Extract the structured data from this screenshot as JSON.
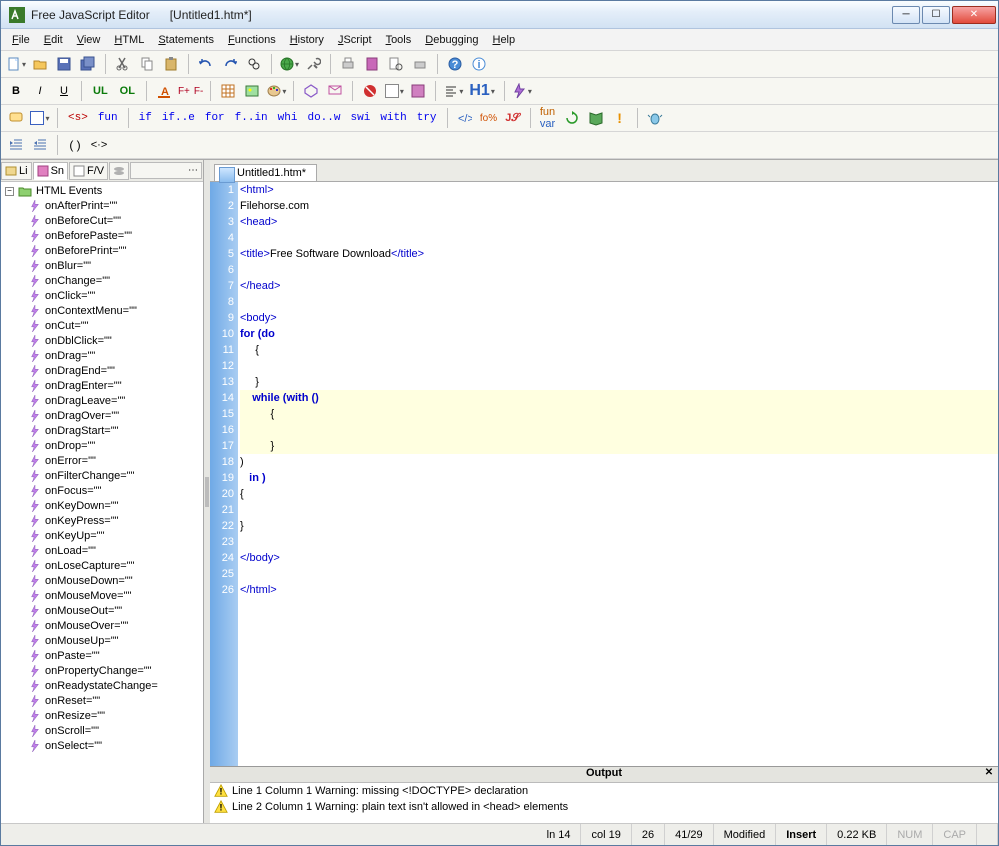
{
  "window": {
    "app_title": "Free JavaScript Editor",
    "doc_title": "[Untitled1.htm*]"
  },
  "menu": [
    "File",
    "Edit",
    "View",
    "HTML",
    "Statements",
    "Functions",
    "History",
    "JScript",
    "Tools",
    "Debugging",
    "Help"
  ],
  "snippet_bar": [
    "<s>",
    "fun",
    "if",
    "if..e",
    "for",
    "f..in",
    "whi",
    "do..w",
    "swi",
    "with",
    "try"
  ],
  "side_tabs": [
    "Li",
    "Sn",
    "F/V"
  ],
  "tree": {
    "root": "HTML Events",
    "items": [
      "onAfterPrint=\"\"",
      "onBeforeCut=\"\"",
      "onBeforePaste=\"\"",
      "onBeforePrint=\"\"",
      "onBlur=\"\"",
      "onChange=\"\"",
      "onClick=\"\"",
      "onContextMenu=\"\"",
      "onCut=\"\"",
      "onDblClick=\"\"",
      "onDrag=\"\"",
      "onDragEnd=\"\"",
      "onDragEnter=\"\"",
      "onDragLeave=\"\"",
      "onDragOver=\"\"",
      "onDragStart=\"\"",
      "onDrop=\"\"",
      "onError=\"\"",
      "onFilterChange=\"\"",
      "onFocus=\"\"",
      "onKeyDown=\"\"",
      "onKeyPress=\"\"",
      "onKeyUp=\"\"",
      "onLoad=\"\"",
      "onLoseCapture=\"\"",
      "onMouseDown=\"\"",
      "onMouseMove=\"\"",
      "onMouseOut=\"\"",
      "onMouseOver=\"\"",
      "onMouseUp=\"\"",
      "onPaste=\"\"",
      "onPropertyChange=\"\"",
      "onReadystateChange=",
      "onReset=\"\"",
      "onResize=\"\"",
      "onScroll=\"\"",
      "onSelect=\"\""
    ]
  },
  "editor": {
    "tab": "Untitled1.htm*",
    "lines": [
      {
        "n": 1,
        "cls": "tag",
        "t": "<html>"
      },
      {
        "n": 2,
        "cls": "txt-line",
        "t": "Filehorse.com"
      },
      {
        "n": 3,
        "cls": "tag",
        "t": "<head>"
      },
      {
        "n": 4,
        "cls": "",
        "t": ""
      },
      {
        "n": 5,
        "cls": "mixed",
        "t": "<title>Free Software Download</title>"
      },
      {
        "n": 6,
        "cls": "",
        "t": ""
      },
      {
        "n": 7,
        "cls": "tag",
        "t": "</head>"
      },
      {
        "n": 8,
        "cls": "",
        "t": ""
      },
      {
        "n": 9,
        "cls": "tag",
        "t": "<body>"
      },
      {
        "n": 10,
        "cls": "kw",
        "t": "for (do"
      },
      {
        "n": 11,
        "cls": "txt-line",
        "t": "     {"
      },
      {
        "n": 12,
        "cls": "",
        "t": ""
      },
      {
        "n": 13,
        "cls": "txt-line",
        "t": "     }"
      },
      {
        "n": 14,
        "cls": "kw hl",
        "t": "    while (with ()"
      },
      {
        "n": 15,
        "cls": "txt-line hl",
        "t": "          {"
      },
      {
        "n": 16,
        "cls": "hl",
        "t": ""
      },
      {
        "n": 17,
        "cls": "txt-line hl",
        "t": "          }"
      },
      {
        "n": 18,
        "cls": "txt-line",
        "t": ")"
      },
      {
        "n": 19,
        "cls": "kw",
        "t": "   in )"
      },
      {
        "n": 20,
        "cls": "txt-line",
        "t": "{"
      },
      {
        "n": 21,
        "cls": "",
        "t": ""
      },
      {
        "n": 22,
        "cls": "txt-line",
        "t": "}"
      },
      {
        "n": 23,
        "cls": "",
        "t": ""
      },
      {
        "n": 24,
        "cls": "tag",
        "t": "</body>"
      },
      {
        "n": 25,
        "cls": "",
        "t": ""
      },
      {
        "n": 26,
        "cls": "tag",
        "t": "</html>"
      }
    ]
  },
  "output": {
    "title": "Output",
    "lines": [
      "Line 1 Column 1  Warning: missing <!DOCTYPE> declaration",
      "Line 2 Column 1  Warning: plain text isn't allowed in <head> elements"
    ]
  },
  "status": {
    "ln": "ln 14",
    "col": "col 19",
    "sel": "26",
    "pos": "41/29",
    "modified": "Modified",
    "insert": "Insert",
    "size": "0.22 KB",
    "num": "NUM",
    "cap": "CAP"
  },
  "labels": {
    "B": "B",
    "I": "I",
    "U": "U",
    "UL": "UL",
    "OL": "OL",
    "F+": "F+",
    "F-": "F-",
    "H1": "H1"
  }
}
